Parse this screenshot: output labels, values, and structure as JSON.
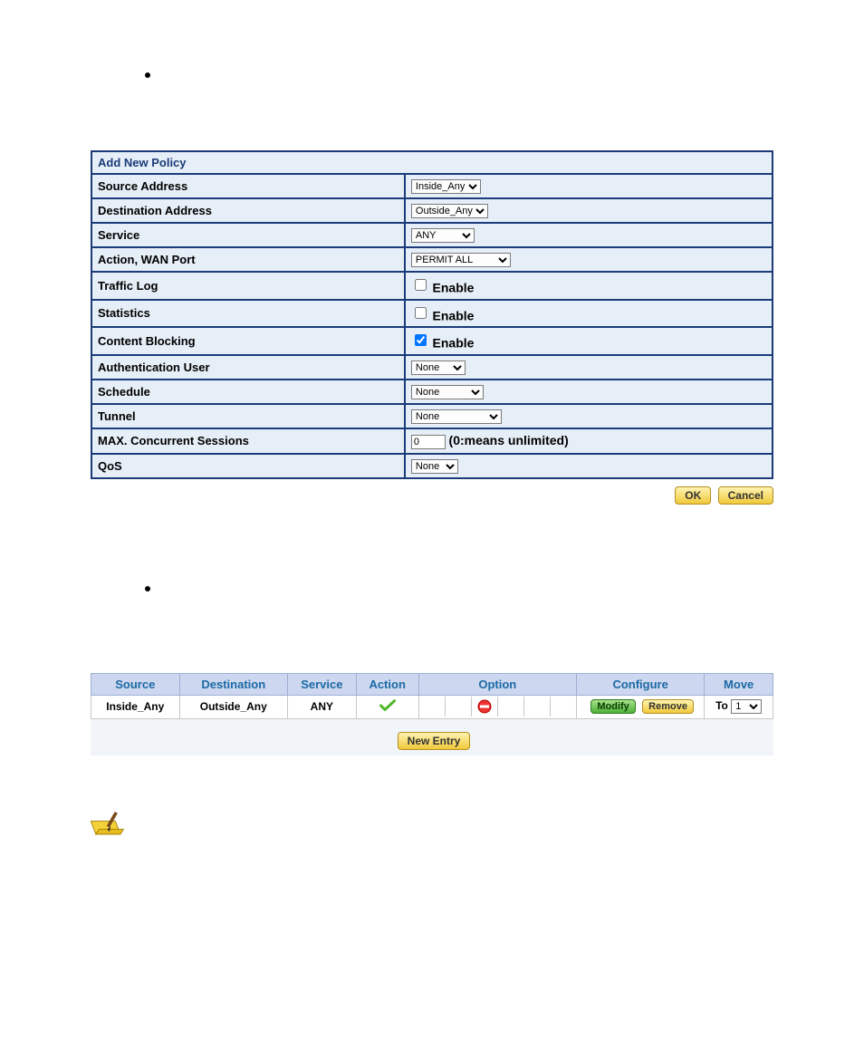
{
  "form": {
    "title": "Add New Policy",
    "rows": {
      "source_address": {
        "label": "Source Address",
        "value": "Inside_Any"
      },
      "destination_address": {
        "label": "Destination Address",
        "value": "Outside_Any"
      },
      "service": {
        "label": "Service",
        "value": "ANY"
      },
      "action_wan_port": {
        "label": "Action, WAN Port",
        "value": "PERMIT ALL"
      },
      "traffic_log": {
        "label": "Traffic Log",
        "checkbox_label": "Enable",
        "checked": false
      },
      "statistics": {
        "label": "Statistics",
        "checkbox_label": "Enable",
        "checked": false
      },
      "content_blocking": {
        "label": "Content Blocking",
        "checkbox_label": "Enable",
        "checked": true
      },
      "authentication_user": {
        "label": "Authentication User",
        "value": "None"
      },
      "schedule": {
        "label": "Schedule",
        "value": "None"
      },
      "tunnel": {
        "label": "Tunnel",
        "value": "None"
      },
      "max_concurrent": {
        "label": "MAX. Concurrent Sessions",
        "value": "0",
        "hint": "(0:means unlimited)"
      },
      "qos": {
        "label": "QoS",
        "value": "None"
      }
    },
    "buttons": {
      "ok": "OK",
      "cancel": "Cancel"
    }
  },
  "policy_table": {
    "headers": {
      "source": "Source",
      "destination": "Destination",
      "service": "Service",
      "action": "Action",
      "option": "Option",
      "configure": "Configure",
      "move": "Move"
    },
    "row": {
      "source": "Inside_Any",
      "destination": "Outside_Any",
      "service": "ANY",
      "configure": {
        "modify": "Modify",
        "remove": "Remove"
      },
      "move": {
        "label": "To",
        "value": "1"
      }
    },
    "new_entry": "New Entry"
  }
}
